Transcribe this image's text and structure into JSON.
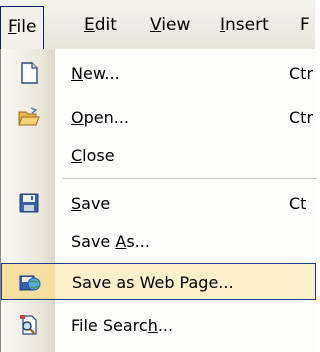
{
  "menubar": {
    "items": [
      {
        "label": "File",
        "accel": "F",
        "rest": "ile",
        "active": true
      },
      {
        "label": "Edit",
        "accel": "E",
        "rest": "dit"
      },
      {
        "label": "View",
        "accel": "V",
        "rest": "iew"
      },
      {
        "label": "Insert",
        "accel": "I",
        "rest": "nsert"
      },
      {
        "label": "F"
      }
    ]
  },
  "file_menu": {
    "new": {
      "accel": "N",
      "rest": "ew...",
      "shortcut": "Ctr",
      "icon": "new-document-icon"
    },
    "open": {
      "accel": "O",
      "rest": "pen...",
      "shortcut": "Ctr",
      "icon": "open-folder-icon"
    },
    "close": {
      "accel": "C",
      "rest": "lose"
    },
    "save": {
      "accel": "S",
      "rest": "ave",
      "shortcut": "Ct",
      "icon": "floppy-disk-icon"
    },
    "save_as": {
      "pre": "Save ",
      "accel": "A",
      "rest": "s..."
    },
    "save_web": {
      "label": "Save as Web Page...",
      "icon": "save-web-page-icon",
      "highlighted": true
    },
    "file_search": {
      "pre": "File Searc",
      "accel": "h",
      "rest": "...",
      "icon": "file-search-icon"
    }
  },
  "colors": {
    "menu_bar": "#e7e4da",
    "highlight_fill": "#fbf0c9",
    "highlight_border": "#1c3e8c"
  }
}
